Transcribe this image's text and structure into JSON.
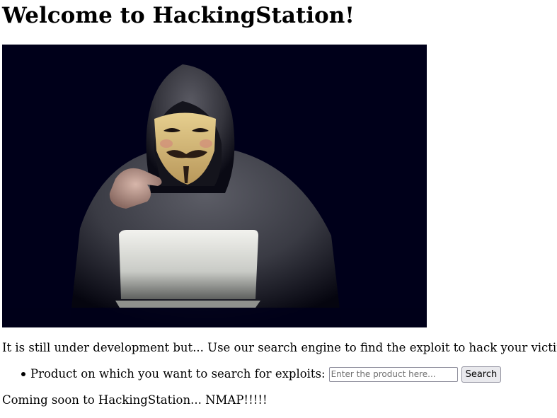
{
  "page": {
    "title": "Welcome to HackingStation!",
    "intro": "It is still under development but... Use our search engine to find the exploit to hack your victim!",
    "coming_soon": "Coming soon to HackingStation... NMAP!!!!!"
  },
  "hero": {
    "subject": "hooded figure wearing a Guy Fawkes mask pointing at viewer behind a laptop"
  },
  "search": {
    "label": "Product on which you want to search for exploits:",
    "placeholder": "Enter the product here...",
    "value": "",
    "button_label": "Search"
  },
  "colors": {
    "background": "#ffffff",
    "text": "#000000",
    "hero_background": "#00001a",
    "button_background": "#e9e9ed",
    "border": "#8f8f9d"
  }
}
